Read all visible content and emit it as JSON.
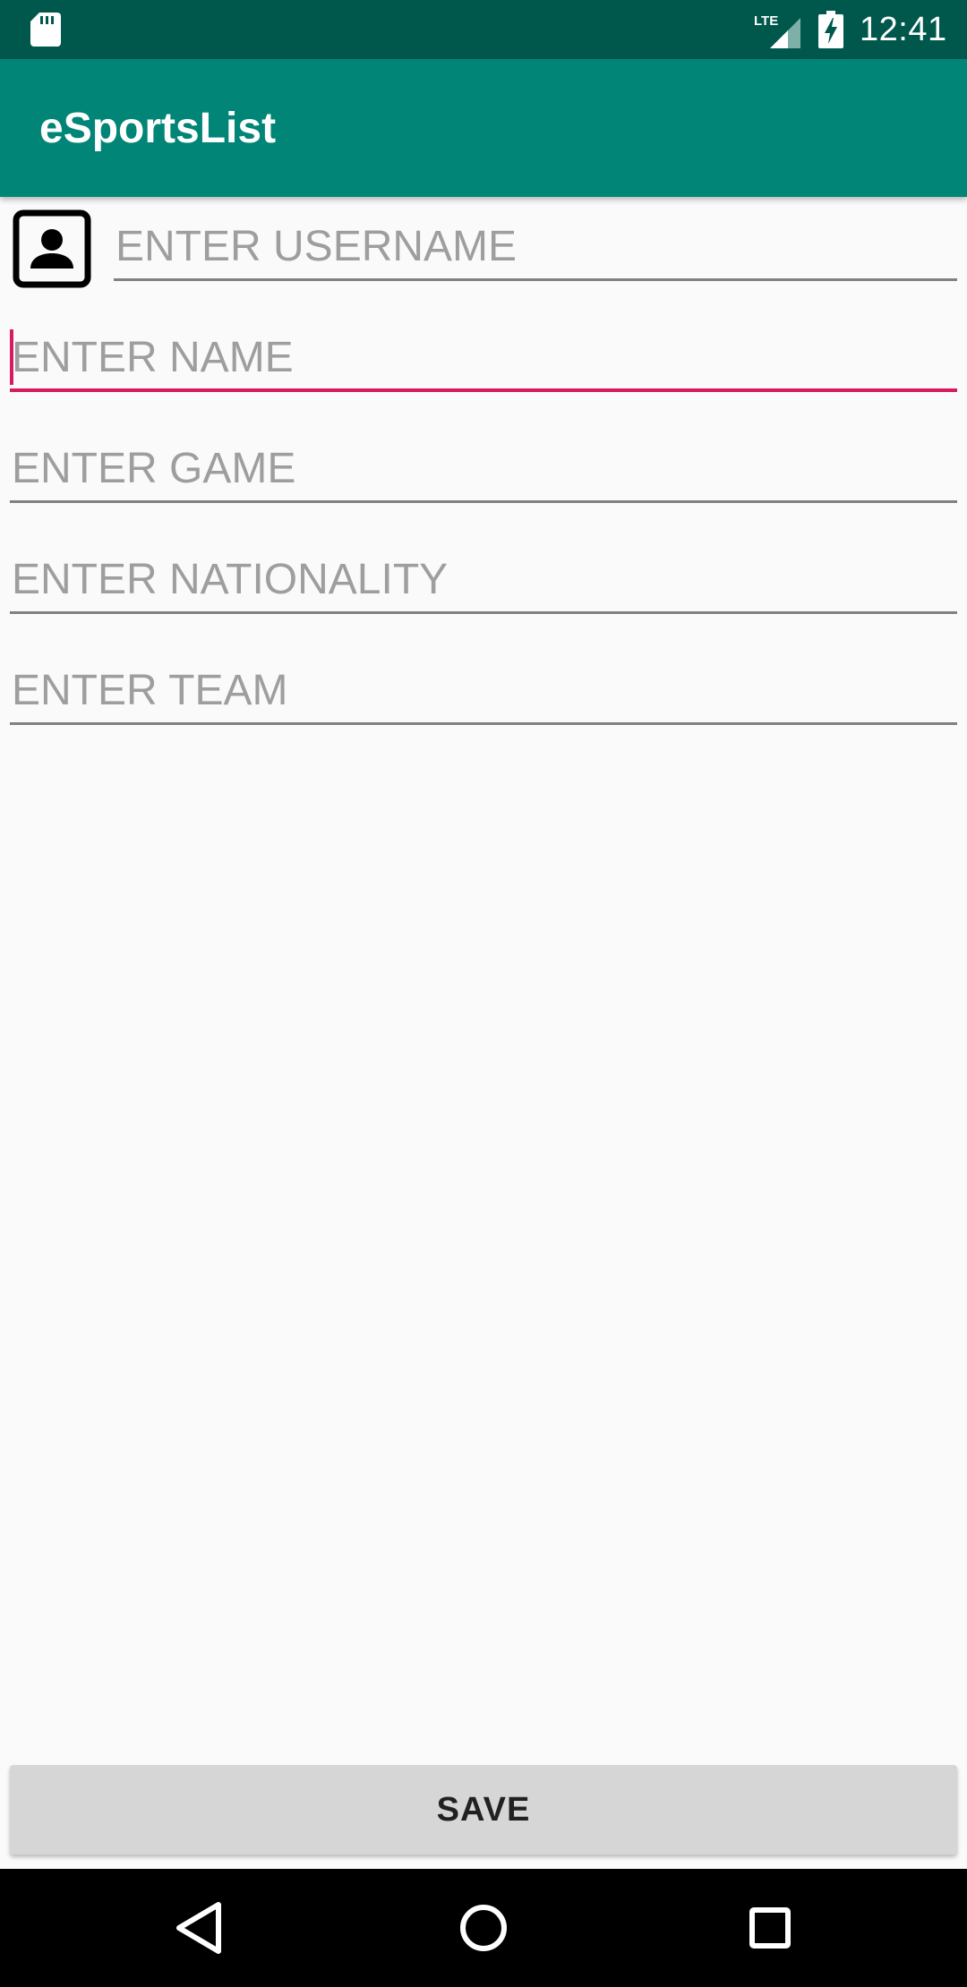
{
  "status_bar": {
    "time": "12:41",
    "network": "LTE",
    "icons": [
      "sd-card-icon",
      "lte-signal-icon",
      "battery-charging-icon"
    ]
  },
  "app_bar": {
    "title": "eSportsList"
  },
  "form": {
    "contact_icon": "contact-card-icon",
    "username": {
      "value": "",
      "placeholder": "ENTER USERNAME"
    },
    "name": {
      "value": "",
      "placeholder": "ENTER NAME"
    },
    "game": {
      "value": "",
      "placeholder": "ENTER GAME"
    },
    "nationality": {
      "value": "",
      "placeholder": "ENTER NATIONALITY"
    },
    "team": {
      "value": "",
      "placeholder": "ENTER TEAM"
    }
  },
  "save_button": {
    "label": "SAVE"
  },
  "nav_bar": {
    "icons": [
      "back-icon",
      "home-icon",
      "recents-icon"
    ]
  },
  "colors": {
    "status_bar": "#00574b",
    "app_bar": "#008577",
    "accent": "#d81b60",
    "background": "#fafafa",
    "button": "#d6d6d6"
  }
}
